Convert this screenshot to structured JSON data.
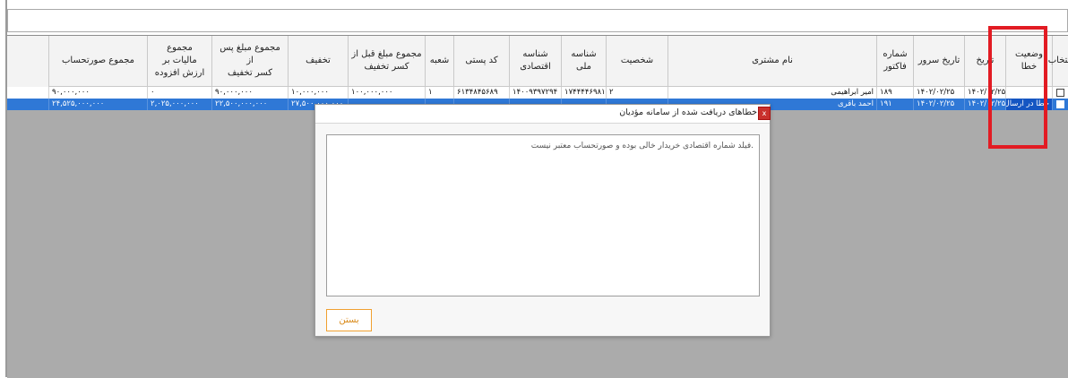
{
  "columns": [
    {
      "label": "انتخاب",
      "w": 18
    },
    {
      "label": "وضعیت خطا",
      "w": 52
    },
    {
      "label": "تاریخ",
      "w": 46
    },
    {
      "label": "تاریخ سرور",
      "w": 57
    },
    {
      "label": "شماره\nفاکتور",
      "w": 41
    },
    {
      "label": "نام مشتری",
      "w": 233
    },
    {
      "label": "شخصیت",
      "w": 69
    },
    {
      "label": "شناسه\nملی",
      "w": 50
    },
    {
      "label": "شناسه\nاقتصادی",
      "w": 58
    },
    {
      "label": "کد پستی",
      "w": 62
    },
    {
      "label": "شعبه",
      "w": 32
    },
    {
      "label": "مجموع مبلغ قبل از\nکسر تخفیف",
      "w": 86
    },
    {
      "label": "تخفیف",
      "w": 67
    },
    {
      "label": "مجموع مبلغ پس از\nکسر تخفیف",
      "w": 85
    },
    {
      "label": "مجموع\nمالیات بر\nارزش افزوده",
      "w": 72
    },
    {
      "label": "مجموع صورتحساب",
      "w": 110
    }
  ],
  "rows": [
    {
      "selected": false,
      "status": "",
      "date": "۱۴۰۲/۰۲/۲۵",
      "server_date": "۱۴۰۲/۰۲/۲۵",
      "invoice_no": "۱۸۹",
      "customer": "امیر ابراهیمی",
      "type": "۲",
      "national_id": "۱۷۴۴۴۴۶۹۸۱",
      "economic_id": "۱۴۰۰۹۳۹۷۲۹۴",
      "postal_code": "۶۱۳۴۸۴۵۶۸۹",
      "branch": "۱",
      "total_before_discount": "۱۰۰,۰۰۰,۰۰۰",
      "discount": "۱۰,۰۰۰,۰۰۰",
      "total_after_discount": "۹۰,۰۰۰,۰۰۰",
      "vat": "۰",
      "invoice_total": "۹۰,۰۰۰,۰۰۰"
    },
    {
      "selected": true,
      "status": "خطا در ارسال",
      "date": "۱۴۰۲/۰۲/۲۵",
      "server_date": "۱۴۰۲/۰۲/۲۵",
      "invoice_no": "۱۹۱",
      "customer": "احمد باقری",
      "type": "",
      "national_id": "",
      "economic_id": "",
      "postal_code": "",
      "branch": "",
      "total_before_discount": "",
      "discount": "۲۷,۵۰۰,۰۰۰,۰۰۰",
      "total_after_discount": "۲۲,۵۰۰,۰۰۰,۰۰۰",
      "vat": "۲,۰۲۵,۰۰۰,۰۰۰",
      "invoice_total": "۲۴,۵۲۵,۰۰۰,۰۰۰"
    }
  ],
  "dialog": {
    "title": "خطاهای دریافت شده از سامانه مؤدیان",
    "close_glyph": "x",
    "message": ".فیلد شماره اقتصادی خریدار خالی بوده و صورتحساب معتبر نیست",
    "close_button": "بستن"
  },
  "colors": {
    "selected_row": "#2f78d6",
    "highlight_box": "#e21b23",
    "close_button_border": "#f0a030"
  }
}
